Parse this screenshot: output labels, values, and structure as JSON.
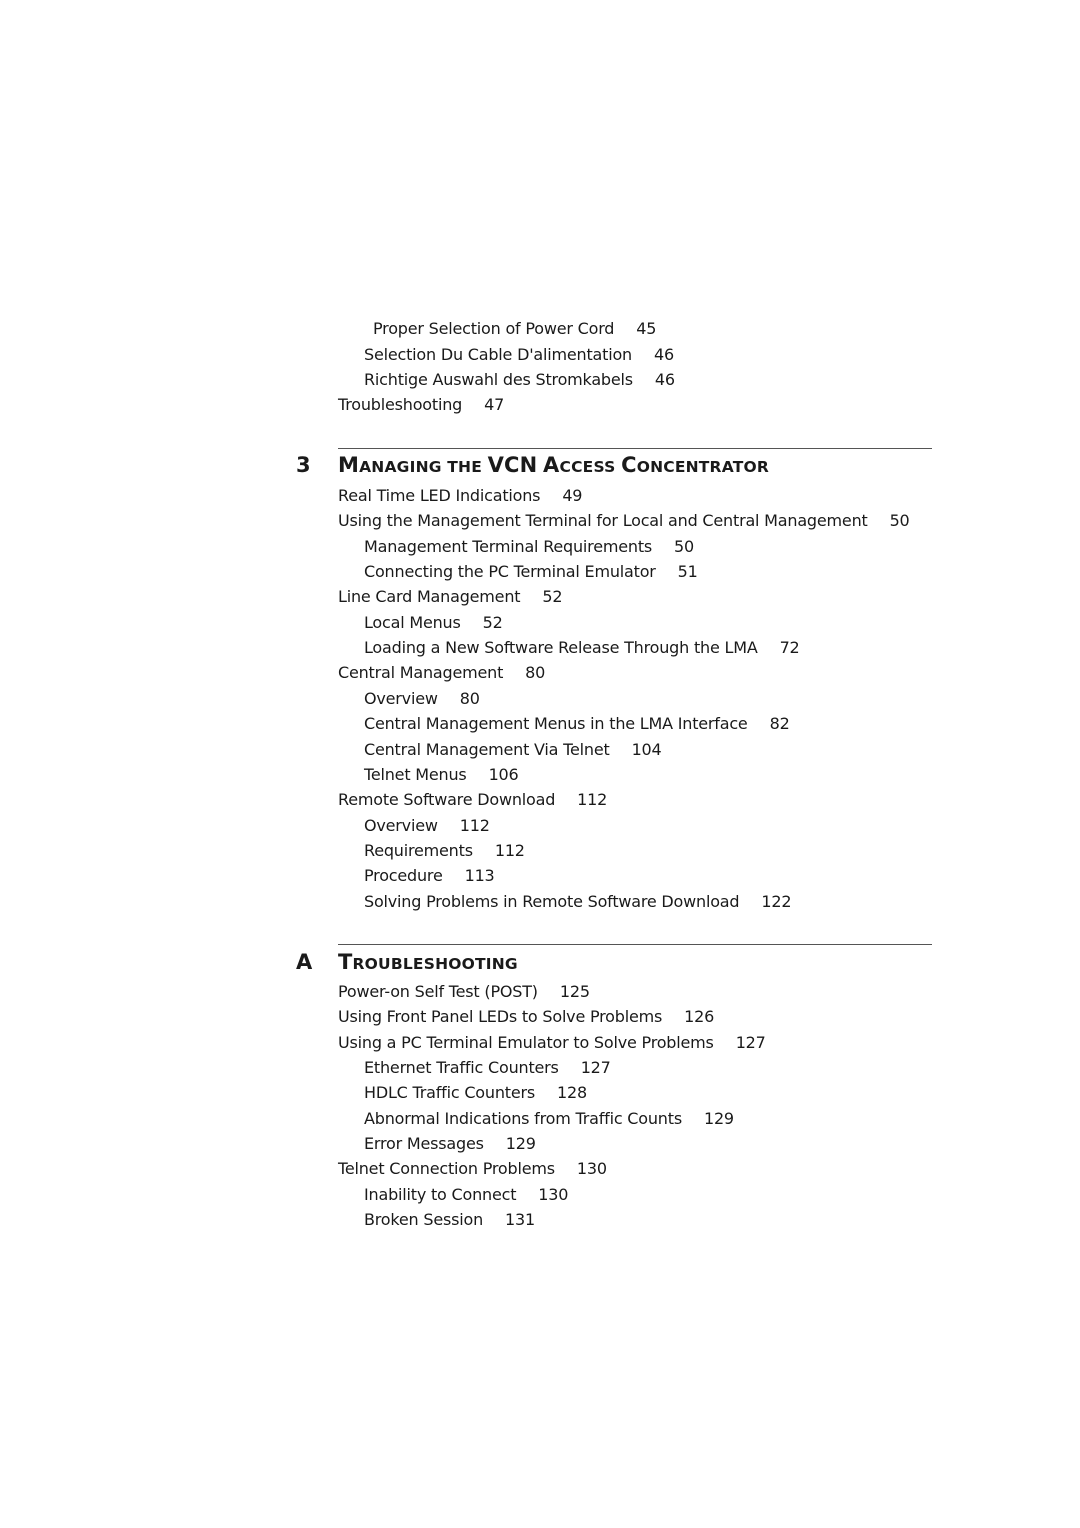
{
  "continued_entries": [
    {
      "title": "Proper Selection of Power Cord",
      "page": "45",
      "level": 3
    },
    {
      "title": "Selection Du Cable D'alimentation",
      "page": "46",
      "level": 2
    },
    {
      "title": "Richtige Auswahl des Stromkabels",
      "page": "46",
      "level": 2
    },
    {
      "title": "Troubleshooting",
      "page": "47",
      "level": 1
    }
  ],
  "chapters": [
    {
      "number": "3",
      "title_parts": [
        {
          "cap": "M",
          "rest": "ANAGING THE "
        },
        {
          "cap": "VCN",
          "rest": " "
        },
        {
          "cap": "A",
          "rest": "CCESS "
        },
        {
          "cap": "C",
          "rest": "ONCENTRATOR"
        }
      ],
      "title": "Managing the VCN Access Concentrator",
      "entries": [
        {
          "title": "Real Time LED Indications",
          "page": "49",
          "level": 1
        },
        {
          "title": "Using the Management Terminal for Local and Central Management",
          "page": "50",
          "level": 1
        },
        {
          "title": "Management Terminal Requirements",
          "page": "50",
          "level": 2
        },
        {
          "title": "Connecting the PC Terminal Emulator",
          "page": "51",
          "level": 2
        },
        {
          "title": "Line Card Management",
          "page": "52",
          "level": 1
        },
        {
          "title": "Local Menus",
          "page": "52",
          "level": 2
        },
        {
          "title": "Loading a New Software Release Through the LMA",
          "page": "72",
          "level": 2
        },
        {
          "title": "Central Management",
          "page": "80",
          "level": 1
        },
        {
          "title": "Overview",
          "page": "80",
          "level": 2
        },
        {
          "title": "Central Management Menus in the LMA Interface",
          "page": "82",
          "level": 2
        },
        {
          "title": "Central Management Via Telnet",
          "page": "104",
          "level": 2
        },
        {
          "title": "Telnet Menus",
          "page": "106",
          "level": 2
        },
        {
          "title": "Remote Software Download",
          "page": "112",
          "level": 1
        },
        {
          "title": "Overview",
          "page": "112",
          "level": 2
        },
        {
          "title": "Requirements",
          "page": "112",
          "level": 2
        },
        {
          "title": "Procedure",
          "page": "113",
          "level": 2
        },
        {
          "title": "Solving Problems in Remote Software Download",
          "page": "122",
          "level": 2
        }
      ]
    },
    {
      "number": "A",
      "title_parts": [
        {
          "cap": "T",
          "rest": "ROUBLESHOOTING"
        }
      ],
      "title": "Troubleshooting",
      "entries": [
        {
          "title": "Power-on Self Test (POST)",
          "page": "125",
          "level": 1
        },
        {
          "title": "Using Front Panel LEDs to Solve Problems",
          "page": "126",
          "level": 1
        },
        {
          "title": "Using a PC Terminal Emulator to Solve Problems",
          "page": "127",
          "level": 1
        },
        {
          "title": "Ethernet Traffic Counters",
          "page": "127",
          "level": 2
        },
        {
          "title": "HDLC Traffic Counters",
          "page": "128",
          "level": 2
        },
        {
          "title": "Abnormal Indications from Traffic Counts",
          "page": "129",
          "level": 2
        },
        {
          "title": "Error Messages",
          "page": "129",
          "level": 2
        },
        {
          "title": "Telnet Connection Problems",
          "page": "130",
          "level": 1
        },
        {
          "title": "Inability to Connect",
          "page": "130",
          "level": 2
        },
        {
          "title": "Broken Session",
          "page": "131",
          "level": 2
        }
      ]
    }
  ]
}
